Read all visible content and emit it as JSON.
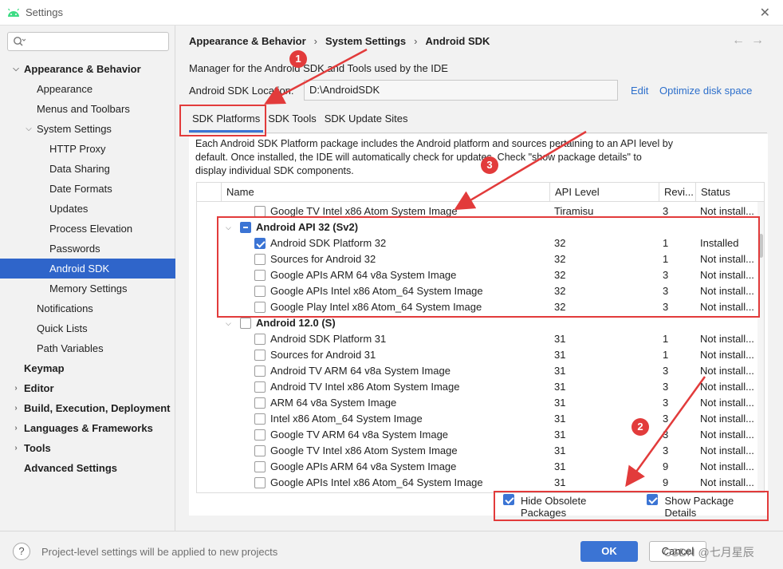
{
  "window": {
    "title": "Settings"
  },
  "sidebar": {
    "search_placeholder": "",
    "items": [
      {
        "label": "Appearance & Behavior",
        "level": 0,
        "bold": true,
        "expanded": true
      },
      {
        "label": "Appearance",
        "level": 1
      },
      {
        "label": "Menus and Toolbars",
        "level": 1
      },
      {
        "label": "System Settings",
        "level": 1,
        "expanded": true
      },
      {
        "label": "HTTP Proxy",
        "level": 2
      },
      {
        "label": "Data Sharing",
        "level": 2
      },
      {
        "label": "Date Formats",
        "level": 2
      },
      {
        "label": "Updates",
        "level": 2
      },
      {
        "label": "Process Elevation",
        "level": 2
      },
      {
        "label": "Passwords",
        "level": 2
      },
      {
        "label": "Android SDK",
        "level": 2,
        "selected": true
      },
      {
        "label": "Memory Settings",
        "level": 2
      },
      {
        "label": "Notifications",
        "level": 1
      },
      {
        "label": "Quick Lists",
        "level": 1
      },
      {
        "label": "Path Variables",
        "level": 1
      },
      {
        "label": "Keymap",
        "level": 0,
        "bold": true
      },
      {
        "label": "Editor",
        "level": 0,
        "bold": true,
        "collapsed": true
      },
      {
        "label": "Build, Execution, Deployment",
        "level": 0,
        "bold": true,
        "collapsed": true
      },
      {
        "label": "Languages & Frameworks",
        "level": 0,
        "bold": true,
        "collapsed": true
      },
      {
        "label": "Tools",
        "level": 0,
        "bold": true,
        "collapsed": true
      },
      {
        "label": "Advanced Settings",
        "level": 0,
        "bold": true
      }
    ]
  },
  "breadcrumb": [
    "Appearance & Behavior",
    "System Settings",
    "Android SDK"
  ],
  "description": "Manager for the Android SDK and Tools used by the IDE",
  "sdk_location": {
    "label": "Android SDK Location:",
    "value": "D:\\AndroidSDK",
    "edit_link": "Edit",
    "optimize_link": "Optimize disk space"
  },
  "tabs": [
    {
      "label": "SDK Platforms",
      "active": true
    },
    {
      "label": "SDK Tools"
    },
    {
      "label": "SDK Update Sites"
    }
  ],
  "panel_description": "Each Android SDK Platform package includes the Android platform and sources pertaining to an API level by default. Once installed, the IDE will automatically check for updates. Check \"show package details\" to display individual SDK components.",
  "table": {
    "columns": [
      "Name",
      "API Level",
      "Revi...",
      "Status"
    ],
    "rows": [
      {
        "kind": "item",
        "name": "Google TV Intel x86 Atom System Image",
        "api": "Tiramisu",
        "rev": "3",
        "status": "Not install...",
        "checked": false
      },
      {
        "kind": "group",
        "name": "Android API 32 (Sv2)",
        "state": "partial",
        "expanded": true
      },
      {
        "kind": "item",
        "name": "Android SDK Platform 32",
        "api": "32",
        "rev": "1",
        "status": "Installed",
        "checked": true
      },
      {
        "kind": "item",
        "name": "Sources for Android 32",
        "api": "32",
        "rev": "1",
        "status": "Not install...",
        "checked": false
      },
      {
        "kind": "item",
        "name": "Google APIs ARM 64 v8a System Image",
        "api": "32",
        "rev": "3",
        "status": "Not install...",
        "checked": false
      },
      {
        "kind": "item",
        "name": "Google APIs Intel x86 Atom_64 System Image",
        "api": "32",
        "rev": "3",
        "status": "Not install...",
        "checked": false
      },
      {
        "kind": "item",
        "name": "Google Play Intel x86 Atom_64 System Image",
        "api": "32",
        "rev": "3",
        "status": "Not install...",
        "checked": false
      },
      {
        "kind": "group",
        "name": "Android 12.0 (S)",
        "state": "unchecked",
        "expanded": true
      },
      {
        "kind": "item",
        "name": "Android SDK Platform 31",
        "api": "31",
        "rev": "1",
        "status": "Not install...",
        "checked": false
      },
      {
        "kind": "item",
        "name": "Sources for Android 31",
        "api": "31",
        "rev": "1",
        "status": "Not install...",
        "checked": false
      },
      {
        "kind": "item",
        "name": "Android TV ARM 64 v8a System Image",
        "api": "31",
        "rev": "3",
        "status": "Not install...",
        "checked": false
      },
      {
        "kind": "item",
        "name": "Android TV Intel x86 Atom System Image",
        "api": "31",
        "rev": "3",
        "status": "Not install...",
        "checked": false
      },
      {
        "kind": "item",
        "name": "ARM 64 v8a System Image",
        "api": "31",
        "rev": "3",
        "status": "Not install...",
        "checked": false
      },
      {
        "kind": "item",
        "name": "Intel x86 Atom_64 System Image",
        "api": "31",
        "rev": "3",
        "status": "Not install...",
        "checked": false
      },
      {
        "kind": "item",
        "name": "Google TV ARM 64 v8a System Image",
        "api": "31",
        "rev": "3",
        "status": "Not install...",
        "checked": false
      },
      {
        "kind": "item",
        "name": "Google TV Intel x86 Atom System Image",
        "api": "31",
        "rev": "3",
        "status": "Not install...",
        "checked": false
      },
      {
        "kind": "item",
        "name": "Google APIs ARM 64 v8a System Image",
        "api": "31",
        "rev": "9",
        "status": "Not install...",
        "checked": false
      },
      {
        "kind": "item",
        "name": "Google APIs Intel x86 Atom_64 System Image",
        "api": "31",
        "rev": "9",
        "status": "Not install...",
        "checked": false
      }
    ]
  },
  "options": {
    "hide_obsolete": {
      "label": "Hide Obsolete Packages",
      "checked": true
    },
    "show_details": {
      "label": "Show Package Details",
      "checked": true
    }
  },
  "footer": {
    "help": "?",
    "text": "Project-level settings will be applied to new projects",
    "ok": "OK",
    "cancel": "Cancel"
  },
  "watermark": "CSDN @七月星辰",
  "annotations": {
    "badges": [
      "1",
      "2",
      "3"
    ],
    "color": "#e23b3b"
  },
  "colors": {
    "accent": "#3b74d4",
    "selection": "#2f65ca",
    "link": "#2d6fcb"
  }
}
